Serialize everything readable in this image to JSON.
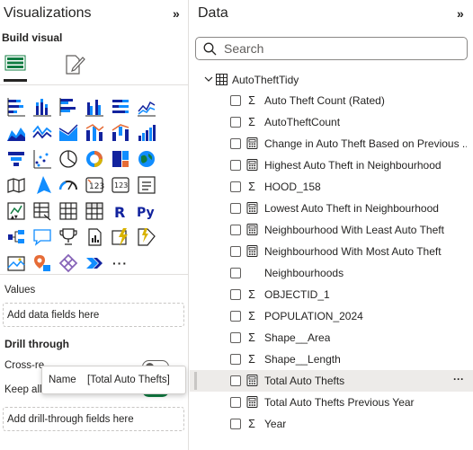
{
  "visualizations": {
    "title": "Visualizations",
    "collapse_icon": "»",
    "build_visual_label": "Build visual",
    "more_label": "···",
    "values_label": "Values",
    "values_placeholder": "Add data fields here",
    "drill_through_label": "Drill through",
    "cross_report_label": "Cross-re",
    "cross_report_on": false,
    "keep_all_label": "Keep all",
    "keep_all_on": true,
    "drill_placeholder": "Add drill-through fields here"
  },
  "tooltip": {
    "key": "Name",
    "value": "[Total Auto Thefts]"
  },
  "data": {
    "title": "Data",
    "collapse_icon": "»",
    "search_placeholder": "Search",
    "table_name": "AutoTheftTidy",
    "fields": [
      {
        "name": "Auto Theft Count (Rated)",
        "type": "sigma"
      },
      {
        "name": "AutoTheftCount",
        "type": "sigma"
      },
      {
        "name": "Change in Auto Theft Based on Previous ...",
        "type": "measure"
      },
      {
        "name": "Highest Auto Theft in Neighbourhood",
        "type": "measure"
      },
      {
        "name": "HOOD_158",
        "type": "sigma"
      },
      {
        "name": "Lowest Auto Theft in Neighbourhood",
        "type": "measure"
      },
      {
        "name": "Neighbourhood With Least Auto Theft",
        "type": "measure"
      },
      {
        "name": "Neighbourhood With Most Auto Theft",
        "type": "measure"
      },
      {
        "name": "Neighbourhoods",
        "type": "none"
      },
      {
        "name": "OBJECTID_1",
        "type": "sigma"
      },
      {
        "name": "POPULATION_2024",
        "type": "sigma"
      },
      {
        "name": "Shape__Area",
        "type": "sigma"
      },
      {
        "name": "Shape__Length",
        "type": "sigma"
      },
      {
        "name": "Total Auto Thefts",
        "type": "measure",
        "more": "···"
      },
      {
        "name": "Total Auto Thefts Previous Year",
        "type": "measure"
      },
      {
        "name": "Year",
        "type": "sigma"
      }
    ]
  },
  "visual_types": [
    [
      "stacked-bar-chart-icon",
      "stacked-column-chart-icon",
      "clustered-bar-chart-icon",
      "clustered-column-chart-icon",
      "100-stacked-bar-chart-icon",
      "line-chart-icon"
    ],
    [
      "area-chart-icon",
      "stacked-area-chart-icon",
      "line-and-column-chart-icon",
      "ribbon-chart-icon",
      "waterfall-chart-icon",
      "filled-map-icon"
    ],
    [
      "funnel-chart-icon",
      "scatter-chart-icon",
      "pie-chart-icon",
      "donut-chart-icon",
      "treemap-icon",
      "map-icon"
    ],
    [
      "shape-map-icon",
      "azure-map-icon",
      "gauge-icon",
      "card-icon",
      "multi-row-card-icon",
      "kpi-icon"
    ],
    [
      "slicer-icon",
      "table-icon",
      "matrix-icon",
      "r-visual-icon",
      "python-visual-icon",
      "key-influencers-icon"
    ],
    [
      "decomposition-tree-icon",
      "qa-icon",
      "smart-narrative-icon",
      "paginated-report-icon",
      "power-apps-icon",
      "power-automate-icon"
    ],
    [
      "arcgis-map-icon",
      "get-more-visuals-icon",
      "more-visuals-icon"
    ]
  ],
  "colors": {
    "accent_green": "#107c41",
    "chart_blue": "#118dff",
    "chart_navy": "#12239e",
    "chart_orange": "#e66c37",
    "chart_gold": "#d9b300"
  }
}
